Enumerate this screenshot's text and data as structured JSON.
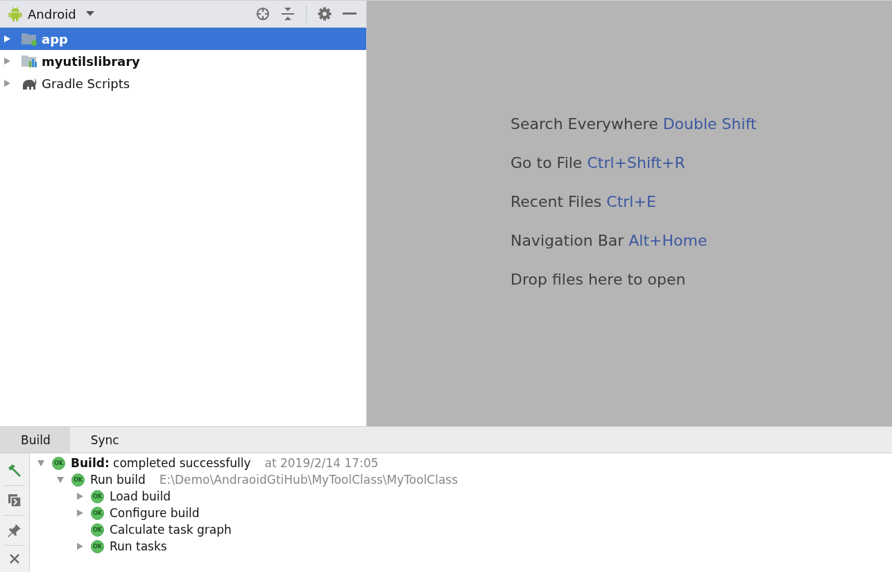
{
  "project_panel": {
    "view": "Android",
    "items": [
      {
        "label": "app",
        "kind": "app-module",
        "bold": true,
        "selected": true,
        "expanded": false
      },
      {
        "label": "myutilslibrary",
        "kind": "library-module",
        "bold": true,
        "selected": false,
        "expanded": false
      },
      {
        "label": "Gradle Scripts",
        "kind": "gradle",
        "bold": false,
        "selected": false,
        "expanded": false
      }
    ]
  },
  "editor_hints": [
    {
      "text": "Search Everywhere",
      "shortcut": "Double Shift"
    },
    {
      "text": "Go to File",
      "shortcut": "Ctrl+Shift+R"
    },
    {
      "text": "Recent Files",
      "shortcut": "Ctrl+E"
    },
    {
      "text": "Navigation Bar",
      "shortcut": "Alt+Home"
    },
    {
      "text": "Drop files here to open"
    }
  ],
  "build_panel": {
    "tabs": [
      {
        "label": "Build",
        "selected": true
      },
      {
        "label": "Sync",
        "selected": false
      }
    ],
    "tree": [
      {
        "badge": "OK",
        "label": "**Build:** completed successfully",
        "detail": "at 2019/2/14 17:05",
        "expanded": true,
        "children": [
          {
            "badge": "OK",
            "label": "Run build",
            "detail": "E:\\Demo\\AndraoidGtiHub\\MyToolClass\\MyToolClass",
            "expanded": true,
            "children": [
              {
                "badge": "OK",
                "label": "Load build",
                "expanded": false
              },
              {
                "badge": "OK",
                "label": "Configure build",
                "expanded": false
              },
              {
                "badge": "OK",
                "label": "Calculate task graph"
              },
              {
                "badge": "OK",
                "label": "Run tasks",
                "expanded": false
              }
            ]
          }
        ]
      }
    ]
  }
}
